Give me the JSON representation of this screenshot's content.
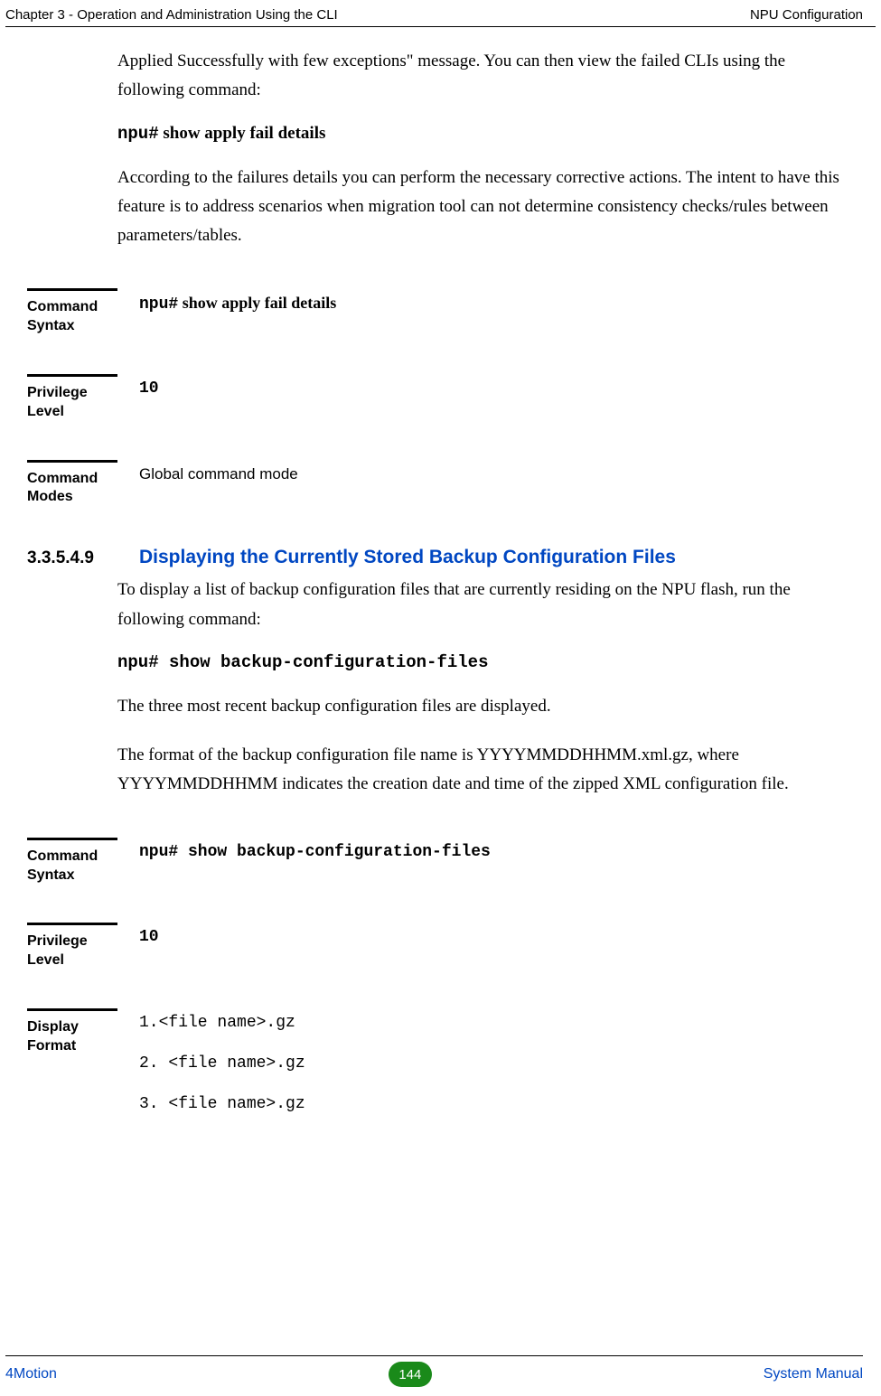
{
  "header": {
    "left": "Chapter 3 - Operation and Administration Using the CLI",
    "right": "NPU Configuration"
  },
  "intro": {
    "p1": "Applied Successfully with few exceptions\" message. You can then view the failed CLIs using the following command:",
    "cmd1_prefix": "npu#",
    "cmd1_rest": " show apply fail details",
    "p2": "According to the failures details you can perform the necessary corrective actions. The intent to have this feature is to address scenarios when migration tool can not determine consistency checks/rules between parameters/tables."
  },
  "block1": {
    "syntax_label": "Command Syntax",
    "syntax_value_prefix": "npu#",
    "syntax_value_rest": " show apply fail details",
    "priv_label": "Privilege Level",
    "priv_value": "10",
    "modes_label": "Command Modes",
    "modes_value": "Global command mode"
  },
  "section": {
    "num": "3.3.5.4.9",
    "title": "Displaying the Currently Stored Backup Configuration Files",
    "p1": "To display a list of backup configuration files that are currently residing on the NPU flash, run the following command:",
    "cmd": "npu# show backup-configuration-files",
    "p2": "The three most recent backup configuration files are displayed.",
    "p3": "The format of the backup configuration file name is YYYYMMDDHHMM.xml.gz, where YYYYMMDDHHMM indicates the creation date and time of the zipped XML configuration file."
  },
  "block2": {
    "syntax_label": "Command Syntax",
    "syntax_value": "npu# show backup-configuration-files",
    "priv_label": "Privilege Level",
    "priv_value": "10",
    "disp_label": "Display Format",
    "disp_l1": "1.<file name>.gz",
    "disp_l2": "2. <file name>.gz",
    "disp_l3": "3. <file name>.gz"
  },
  "footer": {
    "left": "4Motion",
    "page": "144",
    "right": "System Manual"
  }
}
